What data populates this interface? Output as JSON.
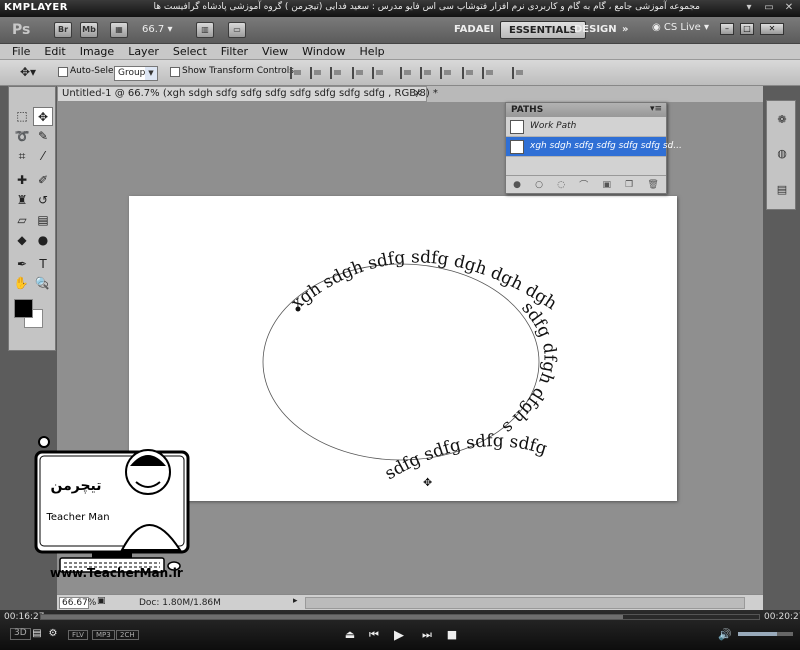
{
  "kmplayer": {
    "logo": "KMPLAYER",
    "caption": "مجموعه آموزشی جامع ، گام به گام و کاربردی نرم افزار فتوشاپ سی اس فایو  مدرس : سعید فدایی (تیچرمن ) گروه آموزشی پادشاه گرافیست ها",
    "controls": [
      "▾",
      "▭",
      "✕"
    ],
    "time_elapsed": "00:16:27",
    "time_total": "00:20:27",
    "progress": 0.81,
    "volume": 0.7,
    "tags": [
      "FLV",
      "MP3",
      "2CH"
    ],
    "mode_3d": "3D"
  },
  "appbar": {
    "ps_logo": "Ps",
    "icons": [
      "Br",
      "Mb"
    ],
    "zoom": "66.7",
    "workspaces": [
      "FADAEI",
      "ESSENTIALS",
      "DESIGN"
    ],
    "active_workspace": "ESSENTIALS",
    "more": "»",
    "cs_live": "CS Live",
    "window_controls": [
      "–",
      "□",
      "✕"
    ]
  },
  "menu": [
    "File",
    "Edit",
    "Image",
    "Layer",
    "Select",
    "Filter",
    "View",
    "Window",
    "Help"
  ],
  "options": {
    "auto_select_label": "Auto-Select:",
    "auto_select_value": "Group",
    "show_transform_label": "Show Transform Controls"
  },
  "document": {
    "tab_title": "Untitled-1 @ 66.7% (xgh sdgh sdfg sdfg sdfg sdfg sdfg sdfg sdfg , RGB/8) *",
    "close": "×",
    "zoom_status": "66.67%",
    "doc_info": "Doc: 1.80M/1.86M"
  },
  "path_text": {
    "upper": "xgh sdgh sdfg sdfg dgh dgh dgh",
    "right": "sdfg dfgh dfgh sdfg",
    "lower": "sdfg sdfg sdfg sdfg"
  },
  "paths_panel": {
    "title": "PATHS",
    "rows": [
      {
        "name": "Work Path",
        "selected": false
      },
      {
        "name": "xgh sdgh sdfg sdfg sdfg sdfg sd...",
        "selected": true
      }
    ]
  },
  "watermark": {
    "brand_fa": "تیچرمن",
    "brand_en": "Teacher Man",
    "url": "www.TeacherMan.ir"
  },
  "colors": {
    "selection": "#2f6fd5",
    "foreground": "#000000",
    "background": "#ffffff"
  }
}
